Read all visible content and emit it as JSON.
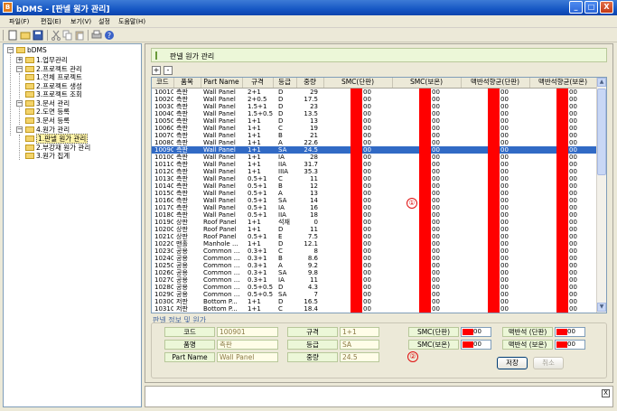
{
  "window": {
    "title": "bDMS - [판넬 원가 관리]",
    "app_icon": "B",
    "controls": [
      "_",
      "□",
      "X"
    ]
  },
  "menu": [
    "파일(F)",
    "편집(E)",
    "보기(V)",
    "설정",
    "도움말(H)"
  ],
  "toolbar_icons": [
    "new-icon",
    "open-icon",
    "save-icon",
    "cut-icon",
    "copy-icon",
    "paste-icon",
    "print-icon",
    "help-icon"
  ],
  "tree": {
    "root": "bDMS",
    "nodes": [
      {
        "label": "1.업무관리"
      },
      {
        "label": "2.프로젝트 관리"
      },
      {
        "label": "1.전체 프로젝트"
      },
      {
        "label": "2.프로젝트 생성"
      },
      {
        "label": "3.프로젝트 조회"
      },
      {
        "label": "3.문서 관리"
      },
      {
        "label": "2.도면 등록"
      },
      {
        "label": "3.문서 등록"
      },
      {
        "label": "4.원가 관리"
      },
      {
        "label": "1.판넬 원가 관리"
      },
      {
        "label": "2.부강재 원가 관리"
      },
      {
        "label": "3.원가 집계"
      }
    ]
  },
  "main": {
    "header": "판넬 원가 관리",
    "expand_btn": "+",
    "collapse_btn": "-",
    "marker1": "①",
    "marker2": "②"
  },
  "grid": {
    "columns": [
      "코드",
      "품목",
      "Part Name",
      "규격",
      "등급",
      "중량",
      "SMC(단판)",
      "SMC(보온)",
      "맥반석향균(단판)",
      "맥반석향균(보온)"
    ],
    "color_value": "00",
    "selected_index": 8,
    "rows": [
      [
        "100101",
        "측판",
        "Wall Panel",
        "2+1",
        "D",
        "29"
      ],
      [
        "100201",
        "측판",
        "Wall Panel",
        "2+0.5",
        "D",
        "17.5"
      ],
      [
        "100301",
        "측판",
        "Wall Panel",
        "1.5+1",
        "D",
        "23"
      ],
      [
        "100401",
        "측판",
        "Wall Panel",
        "1.5+0.5",
        "D",
        "13.5"
      ],
      [
        "100501",
        "측판",
        "Wall Panel",
        "1+1",
        "D",
        "13"
      ],
      [
        "100601",
        "측판",
        "Wall Panel",
        "1+1",
        "C",
        "19"
      ],
      [
        "100701",
        "측판",
        "Wall Panel",
        "1+1",
        "B",
        "21"
      ],
      [
        "100801",
        "측판",
        "Wall Panel",
        "1+1",
        "A",
        "22.6"
      ],
      [
        "100901",
        "측판",
        "Wall Panel",
        "1+1",
        "SA",
        "24.5"
      ],
      [
        "101001",
        "측판",
        "Wall Panel",
        "1+1",
        "IA",
        "28"
      ],
      [
        "101101",
        "측판",
        "Wall Panel",
        "1+1",
        "IIA",
        "31.7"
      ],
      [
        "101201",
        "측판",
        "Wall Panel",
        "1+1",
        "IIIA",
        "35.3"
      ],
      [
        "101301",
        "측판",
        "Wall Panel",
        "0.5+1",
        "C",
        "11"
      ],
      [
        "101401",
        "측판",
        "Wall Panel",
        "0.5+1",
        "B",
        "12"
      ],
      [
        "101501",
        "측판",
        "Wall Panel",
        "0.5+1",
        "A",
        "13"
      ],
      [
        "101601",
        "측판",
        "Wall Panel",
        "0.5+1",
        "SA",
        "14"
      ],
      [
        "101701",
        "측판",
        "Wall Panel",
        "0.5+1",
        "IA",
        "16"
      ],
      [
        "101801",
        "측판",
        "Wall Panel",
        "0.5+1",
        "IIA",
        "18"
      ],
      [
        "101901",
        "상판",
        "Roof Panel",
        "1+1",
        "석재",
        "0"
      ],
      [
        "102001",
        "상판",
        "Roof Panel",
        "1+1",
        "D",
        "11"
      ],
      [
        "102101",
        "상판",
        "Roof Panel",
        "0.5+1",
        "E",
        "7.5"
      ],
      [
        "102201",
        "맨홀",
        "Manhole ...",
        "1+1",
        "D",
        "12.1"
      ],
      [
        "102301",
        "공용",
        "Common ...",
        "0.3+1",
        "C",
        "8"
      ],
      [
        "102401",
        "공용",
        "Common ...",
        "0.3+1",
        "B",
        "8.6"
      ],
      [
        "102501",
        "공용",
        "Common ...",
        "0.3+1",
        "A",
        "9.2"
      ],
      [
        "102601",
        "공용",
        "Common ...",
        "0.3+1",
        "SA",
        "9.8"
      ],
      [
        "102701",
        "공용",
        "Common ...",
        "0.3+1",
        "IA",
        "11"
      ],
      [
        "102801",
        "공용",
        "Common ...",
        "0.5+0.5",
        "D",
        "4.3"
      ],
      [
        "102901",
        "공용",
        "Common ...",
        "0.5+0.5",
        "SA",
        "7"
      ],
      [
        "103001",
        "저판",
        "Bottom P...",
        "1+1",
        "D",
        "16.5"
      ],
      [
        "103101",
        "저판",
        "Bottom P...",
        "1+1",
        "C",
        "18.4"
      ]
    ]
  },
  "detail": {
    "title": "판넬 정보 및 원가",
    "code_label": "코드",
    "code_value": "100901",
    "item_label": "품명",
    "item_value": "측판",
    "part_label": "Part Name",
    "part_value": "Wall Panel",
    "spec_label": "규격",
    "spec_value": "1+1",
    "grade_label": "등급",
    "grade_value": "SA",
    "weight_label": "중량",
    "weight_value": "24.5",
    "smc_single_label": "SMC(단판)",
    "smc_single_value": "00",
    "smc_insul_label": "SMC(보온)",
    "smc_insul_value": "00",
    "mb_single_label": "맥반석 (단판)",
    "mb_single_value": "00",
    "mb_insul_label": "맥반석 (보온)",
    "mb_insul_value": "00",
    "save_btn": "저장",
    "cancel_btn": "취소"
  },
  "bottom_close": "X",
  "colors": {
    "swatch": "#ff0000",
    "selection": "#316ac5",
    "label_bg": "#ecf7d8",
    "titlebar": "#1657c4"
  }
}
